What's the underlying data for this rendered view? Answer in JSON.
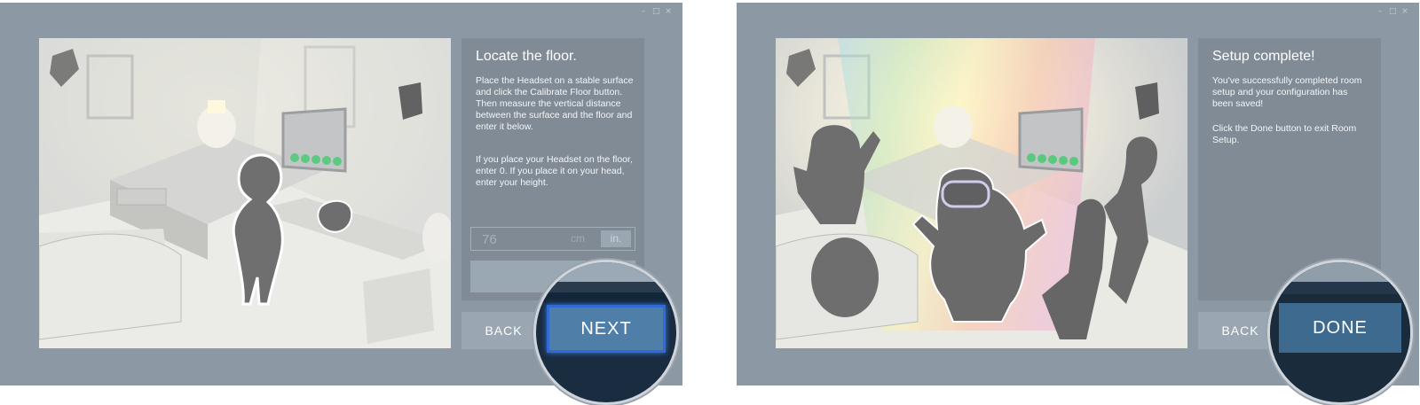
{
  "steps": [
    {
      "title": "Locate the floor.",
      "paragraphs": [
        "Place the Headset on a stable surface and click the Calibrate Floor button. Then measure the vertical distance between the surface and the floor and enter it below.",
        "If you place your Headset on the floor, enter 0. If you place it on your head, enter your height."
      ],
      "height_input": {
        "value": "76",
        "unit_cm": "cm",
        "unit_in": "in."
      },
      "back_label": "BACK",
      "primary_label": "NEXT"
    },
    {
      "title": "Setup complete!",
      "paragraphs": [
        "You've successfully completed room setup and your configuration has been saved!",
        "Click the Done button to exit Room Setup."
      ],
      "back_label": "BACK",
      "primary_label": "DONE"
    }
  ],
  "window_controls": [
    "–",
    "□",
    "×"
  ],
  "colors": {
    "window_bg": "#8c98a3",
    "panel_bg": "#808b96",
    "button_bg": "#9aa6b1",
    "primary_highlight": "#4f7fa8"
  }
}
